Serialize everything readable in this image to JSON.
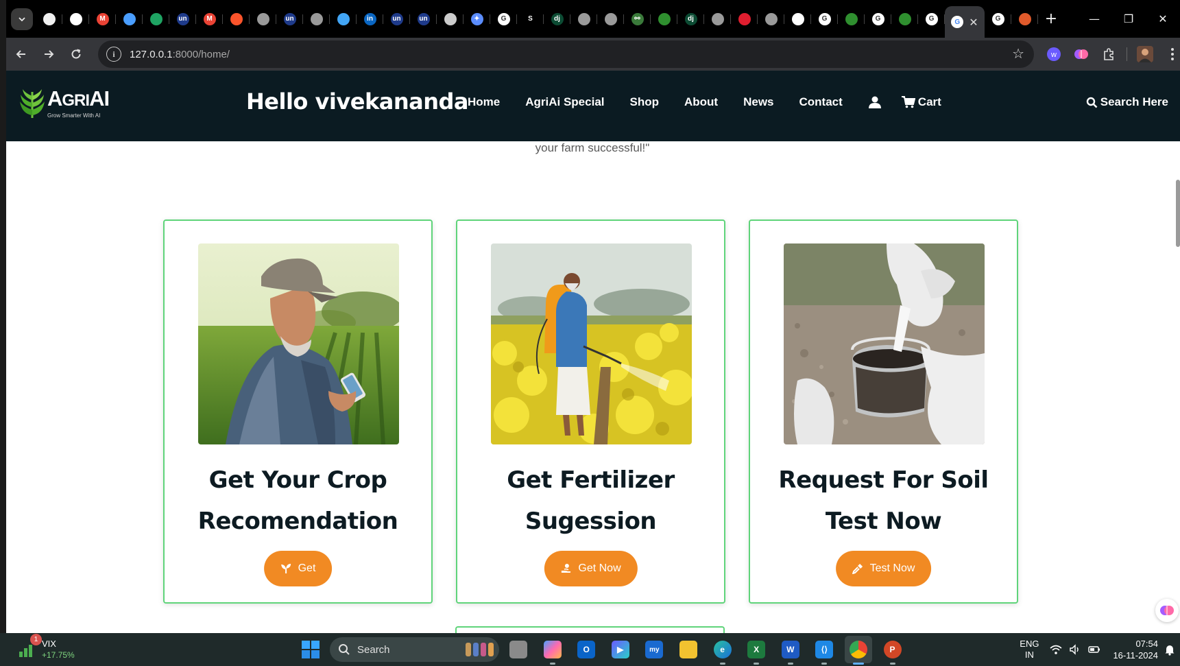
{
  "browser": {
    "tabs": [
      {
        "icon": "profile-icon",
        "color": "#f0f0f0",
        "glyph": ""
      },
      {
        "icon": "github-icon",
        "color": "#ffffff",
        "glyph": ""
      },
      {
        "icon": "gmail-icon",
        "color": "#ea4335",
        "glyph": "M"
      },
      {
        "icon": "app-icon",
        "color": "#4a9eff",
        "glyph": ""
      },
      {
        "icon": "sheets-icon",
        "color": "#1fa463",
        "glyph": ""
      },
      {
        "icon": "unstop-icon",
        "color": "#1e3a8a",
        "glyph": "un"
      },
      {
        "icon": "gmail-icon",
        "color": "#ea4335",
        "glyph": "M"
      },
      {
        "icon": "brave-icon",
        "color": "#fb542b",
        "glyph": ""
      },
      {
        "icon": "globe-icon",
        "color": "#9a9a9a",
        "glyph": ""
      },
      {
        "icon": "unstop-icon",
        "color": "#1e3a8a",
        "glyph": "un"
      },
      {
        "icon": "globe-icon",
        "color": "#9a9a9a",
        "glyph": ""
      },
      {
        "icon": "flutter-icon",
        "color": "#42a5f5",
        "glyph": ""
      },
      {
        "icon": "linkedin-icon",
        "color": "#0a66c2",
        "glyph": "in"
      },
      {
        "icon": "unstop-icon",
        "color": "#1e3a8a",
        "glyph": "un"
      },
      {
        "icon": "unstop-icon",
        "color": "#1e3a8a",
        "glyph": "un"
      },
      {
        "icon": "github-icon",
        "color": "#cccccc",
        "glyph": ""
      },
      {
        "icon": "gemini-icon",
        "color": "#5b8dff",
        "glyph": "✦"
      },
      {
        "icon": "google-icon",
        "color": "#ffffff",
        "glyph": "G"
      },
      {
        "icon": "s-icon",
        "color": "#000000",
        "glyph": "S"
      },
      {
        "icon": "django-icon",
        "color": "#0c4b33",
        "glyph": "dj"
      },
      {
        "icon": "globe-icon",
        "color": "#9a9a9a",
        "glyph": ""
      },
      {
        "icon": "globe-icon",
        "color": "#9a9a9a",
        "glyph": ""
      },
      {
        "icon": "code-icon",
        "color": "#3a7a3a",
        "glyph": "⚯"
      },
      {
        "icon": "leaf-icon",
        "color": "#2f8f2f",
        "glyph": ""
      },
      {
        "icon": "django-icon",
        "color": "#0c4b33",
        "glyph": "dj"
      },
      {
        "icon": "globe-icon",
        "color": "#9a9a9a",
        "glyph": ""
      },
      {
        "icon": "twilio-icon",
        "color": "#e01e2f",
        "glyph": ""
      },
      {
        "icon": "globe-icon",
        "color": "#9a9a9a",
        "glyph": ""
      },
      {
        "icon": "github-icon",
        "color": "#ffffff",
        "glyph": ""
      },
      {
        "icon": "google-icon",
        "color": "#ffffff",
        "glyph": "G"
      },
      {
        "icon": "leaf-icon",
        "color": "#2f8f2f",
        "glyph": ""
      },
      {
        "icon": "google-icon",
        "color": "#ffffff",
        "glyph": "G"
      },
      {
        "icon": "leaf-icon",
        "color": "#2f8f2f",
        "glyph": ""
      },
      {
        "icon": "google-icon",
        "color": "#ffffff",
        "glyph": "G"
      }
    ],
    "active_tab_icon": "google-icon",
    "after_tabs": [
      {
        "icon": "google-icon",
        "color": "#ffffff",
        "glyph": "G"
      },
      {
        "icon": "app-icon",
        "color": "#e05a2b",
        "glyph": ""
      }
    ],
    "url_host": "127.0.0.1",
    "url_rest": ":8000/home/"
  },
  "site": {
    "logo_name_big": "A",
    "logo_name_small": "GRI",
    "logo_name_end": "AI",
    "logo_tagline": "Grow Smarter With AI",
    "greeting": "Hello vivekananda",
    "nav": {
      "home": "Home",
      "special": "AgriAi Special",
      "shop": "Shop",
      "about": "About",
      "news": "News",
      "contact": "Contact",
      "cart": "Cart"
    },
    "search_label": "Search Here",
    "brand_color": "#0b1b22",
    "accent_color": "#f18a23",
    "card_border_color": "#5fd47a"
  },
  "content": {
    "quote_tail": "your farm successful!\"",
    "cards": [
      {
        "title": "Get Your Crop Recomendation",
        "button": "Get",
        "button_icon": "seedling-icon",
        "image": "farmer-with-phone-image"
      },
      {
        "title": "Get Fertilizer Sugession",
        "button": "Get Now",
        "button_icon": "hand-holding-icon",
        "image": "farmer-spraying-field-image"
      },
      {
        "title": "Request For Soil Test Now",
        "button": "Test Now",
        "button_icon": "eyedropper-icon",
        "image": "soil-sample-jar-image"
      }
    ]
  },
  "taskbar": {
    "weather_title": "VIX",
    "weather_change": "+17.75%",
    "weather_badge": "1",
    "search_placeholder": "Search",
    "lang_top": "ENG",
    "lang_bottom": "IN",
    "time": "07:54",
    "date": "16-11-2024"
  }
}
